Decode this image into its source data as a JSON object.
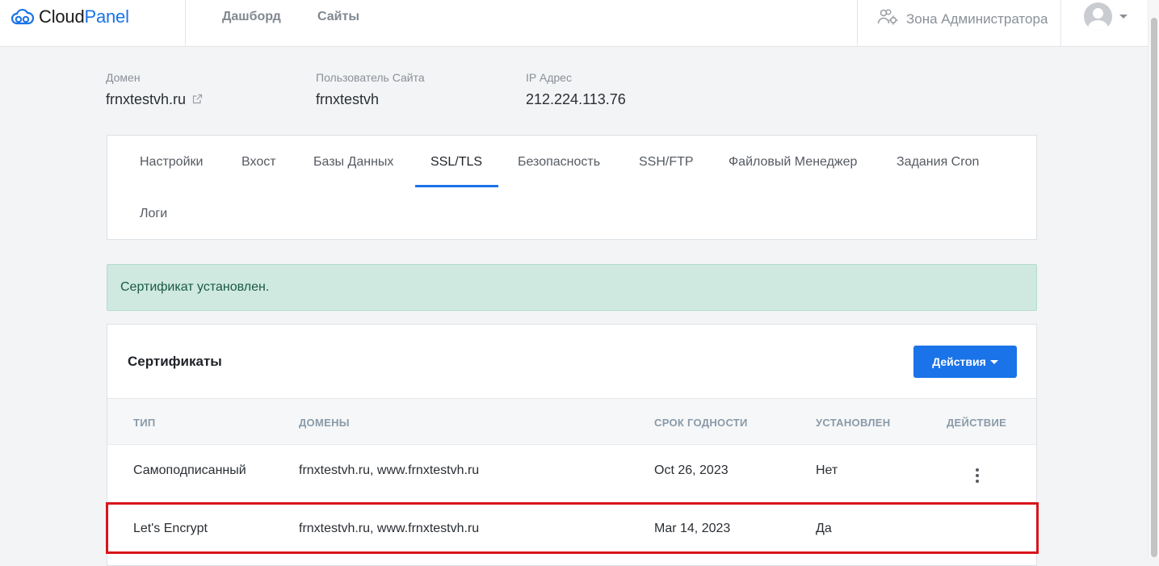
{
  "brand": {
    "part1": "Cloud",
    "part2": "Panel"
  },
  "nav": {
    "dashboard": "Дашборд",
    "sites": "Сайты",
    "admin_zone": "Зона Администратора"
  },
  "meta": {
    "domain_label": "Домен",
    "domain_value": "frnxtestvh.ru",
    "user_label": "Пользователь Сайта",
    "user_value": "frnxtestvh",
    "ip_label": "IP Адрес",
    "ip_value": "212.224.113.76"
  },
  "tabs": {
    "settings": "Настройки",
    "vhost": "Вхост",
    "databases": "Базы Данных",
    "ssl": "SSL/TLS",
    "security": "Безопасность",
    "ssh": "SSH/FTP",
    "files": "Файловый Менеджер",
    "cron": "Задания Cron",
    "logs": "Логи"
  },
  "alert": "Сертификат установлен.",
  "certificates": {
    "title": "Сертификаты",
    "actions_button": "Действия",
    "columns": {
      "type": "ТИП",
      "domains": "ДОМЕНЫ",
      "expiry": "СРОК ГОДНОСТИ",
      "installed": "УСТАНОВЛЕН",
      "action": "ДЕЙСТВИЕ"
    },
    "rows": [
      {
        "type": "Самоподписанный",
        "domains": "frnxtestvh.ru, www.frnxtestvh.ru",
        "expiry": "Oct 26, 2023",
        "installed": "Нет"
      },
      {
        "type": "Let's Encrypt",
        "domains": "frnxtestvh.ru, www.frnxtestvh.ru",
        "expiry": "Mar 14, 2023",
        "installed": "Да"
      }
    ]
  },
  "colors": {
    "accent": "#1a73e8",
    "alert_bg": "#cfe9e0",
    "highlight": "#d9151b"
  }
}
